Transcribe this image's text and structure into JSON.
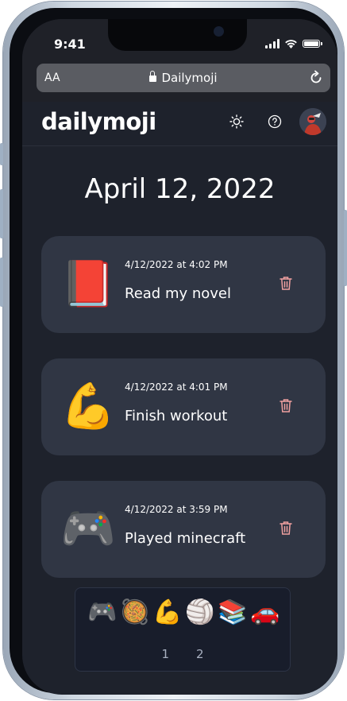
{
  "status": {
    "time": "9:41"
  },
  "browser": {
    "text_size": "AA",
    "url": "Dailymoji"
  },
  "app": {
    "logo": "dailymoji",
    "icons": [
      "sun-icon",
      "help-icon"
    ],
    "date_heading": "April 12, 2022"
  },
  "entries": [
    {
      "emoji": "📕",
      "timestamp": "4/12/2022 at 4:02 PM",
      "title": "Read my novel"
    },
    {
      "emoji": "💪",
      "timestamp": "4/12/2022 at 4:01 PM",
      "title": "Finish workout"
    },
    {
      "emoji": "🎮",
      "timestamp": "4/12/2022 at 3:59 PM",
      "title": "Played minecraft"
    }
  ],
  "picker": {
    "emojis": [
      "🎮",
      "🥘",
      "💪",
      "🏐",
      "📚",
      "🚗"
    ],
    "pages": [
      "1",
      "2"
    ]
  },
  "colors": {
    "background": "#1e222c",
    "card": "#303644",
    "trash": "#f0a0a0",
    "picker_bg": "#181d2b"
  }
}
